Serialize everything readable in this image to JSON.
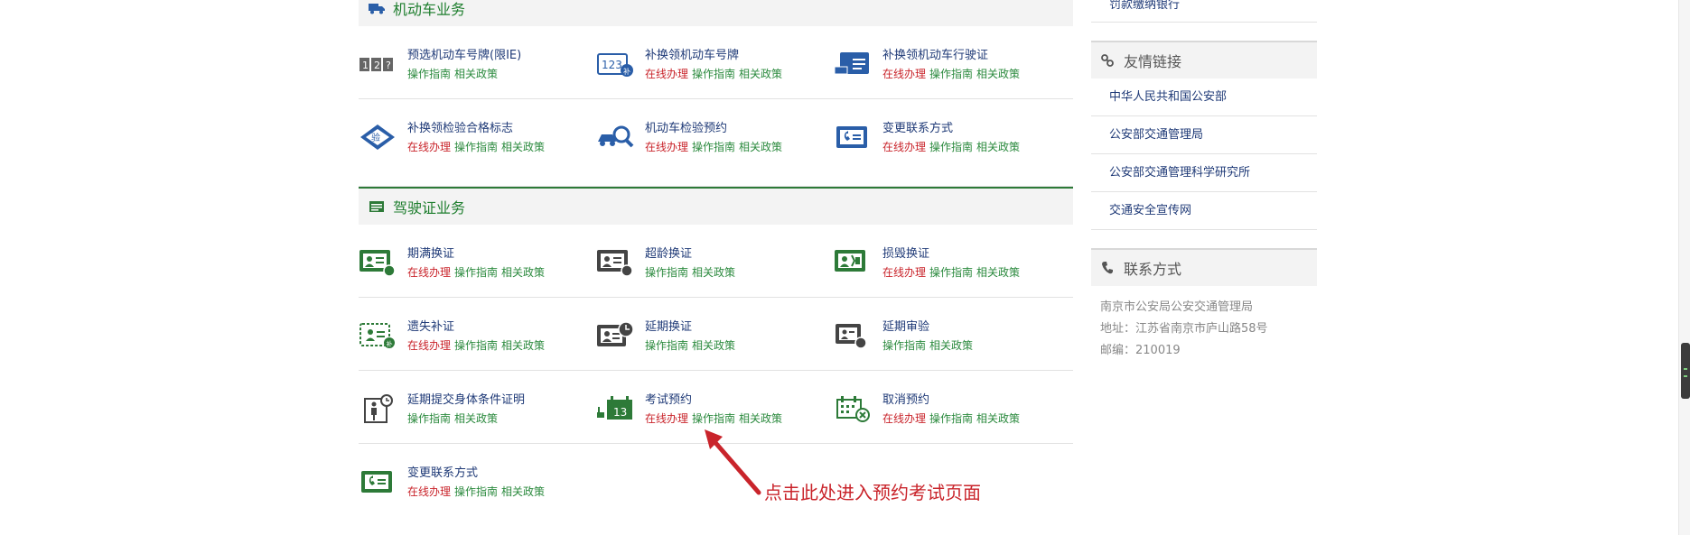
{
  "vehicle_section": {
    "title": "机动车业务",
    "rows": [
      [
        {
          "name": "预选机动车号牌(限IE)",
          "links": [
            "操作指南",
            "相关政策"
          ],
          "icon": "number-plate-icon"
        },
        {
          "name": "补换领机动车号牌",
          "links": [
            "在线办理",
            "操作指南",
            "相关政策"
          ],
          "icon": "plate-replace-icon"
        },
        {
          "name": "补换领机动车行驶证",
          "links": [
            "在线办理",
            "操作指南",
            "相关政策"
          ],
          "icon": "vehicle-license-icon"
        }
      ],
      [
        {
          "name": "补换领检验合格标志",
          "links": [
            "在线办理",
            "操作指南",
            "相关政策"
          ],
          "icon": "inspection-badge-icon"
        },
        {
          "name": "机动车检验预约",
          "links": [
            "在线办理",
            "操作指南",
            "相关政策"
          ],
          "icon": "car-inspection-icon"
        },
        {
          "name": "变更联系方式",
          "links": [
            "在线办理",
            "操作指南",
            "相关政策"
          ],
          "icon": "contact-change-icon"
        }
      ]
    ]
  },
  "license_section": {
    "title": "驾驶证业务",
    "rows": [
      [
        {
          "name": "期满换证",
          "links": [
            "在线办理",
            "操作指南",
            "相关政策"
          ],
          "icon": "expiry-renew-icon"
        },
        {
          "name": "超龄换证",
          "links": [
            "操作指南",
            "相关政策"
          ],
          "icon": "age-renew-icon"
        },
        {
          "name": "损毁换证",
          "links": [
            "在线办理",
            "操作指南",
            "相关政策"
          ],
          "icon": "damaged-renew-icon"
        }
      ],
      [
        {
          "name": "遗失补证",
          "links": [
            "在线办理",
            "操作指南",
            "相关政策"
          ],
          "icon": "lost-reissue-icon"
        },
        {
          "name": "延期换证",
          "links": [
            "操作指南",
            "相关政策"
          ],
          "icon": "delay-renew-icon"
        },
        {
          "name": "延期审验",
          "links": [
            "操作指南",
            "相关政策"
          ],
          "icon": "delay-review-icon"
        }
      ],
      [
        {
          "name": "延期提交身体条件证明",
          "links": [
            "操作指南",
            "相关政策"
          ],
          "icon": "health-proof-icon"
        },
        {
          "name": "考试预约",
          "links": [
            "在线办理",
            "操作指南",
            "相关政策"
          ],
          "icon": "exam-booking-icon"
        },
        {
          "name": "取消预约",
          "links": [
            "在线办理",
            "操作指南",
            "相关政策"
          ],
          "icon": "cancel-booking-icon"
        }
      ],
      [
        {
          "name": "变更联系方式",
          "links": [
            "在线办理",
            "操作指南",
            "相关政策"
          ],
          "icon": "contact-change-icon"
        }
      ]
    ]
  },
  "sidebar": {
    "top_link": "罚款缴纳银行",
    "friend_links_title": "友情链接",
    "friend_links": [
      "中华人民共和国公安部",
      "公安部交通管理局",
      "公安部交通管理科学研究所",
      "交通安全宣传网"
    ],
    "contact_title": "联系方式",
    "contact_lines": [
      "南京市公安局公安交通管理局",
      "地址：江苏省南京市庐山路58号",
      "邮编：210019"
    ]
  },
  "annotation": {
    "text": "点击此处进入预约考试页面",
    "color": "#c9242b"
  },
  "colors": {
    "accent_green": "#2d7a38",
    "link_blue": "#1f3a77",
    "online_red": "#c9242b",
    "guide_green": "#2b8a3e"
  }
}
